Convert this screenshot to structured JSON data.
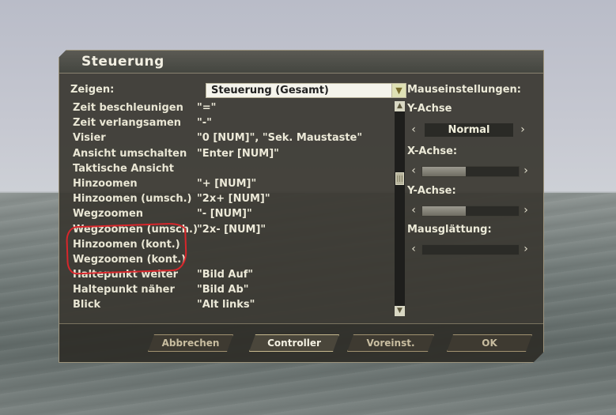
{
  "dialog": {
    "title": "Steuerung"
  },
  "filter": {
    "label": "Zeigen:",
    "value": "Steuerung (Gesamt)"
  },
  "bindings": [
    {
      "action": "Zeit beschleunigen",
      "key": "\"=\""
    },
    {
      "action": "Zeit verlangsamen",
      "key": "\"-\""
    },
    {
      "action": "Visier",
      "key": "\"0 [NUM]\", \"Sek. Maustaste\""
    },
    {
      "action": "Ansicht umschalten",
      "key": "\"Enter [NUM]\""
    },
    {
      "action": "Taktische Ansicht",
      "key": ""
    },
    {
      "action": "Hinzoomen",
      "key": "\"+ [NUM]\""
    },
    {
      "action": "Hinzoomen (umsch.)",
      "key": "\"2x+ [NUM]\""
    },
    {
      "action": "Wegzoomen",
      "key": "\"- [NUM]\""
    },
    {
      "action": "Wegzoomen (umsch.)",
      "key": "\"2x- [NUM]\""
    },
    {
      "action": "Hinzoomen (kont.)",
      "key": ""
    },
    {
      "action": "Wegzoomen (kont.)",
      "key": ""
    },
    {
      "action": "Haltepunkt weiter",
      "key": "\"Bild Auf\""
    },
    {
      "action": "Haltepunkt näher",
      "key": "\"Bild Ab\""
    },
    {
      "action": "Blick",
      "key": "\"Alt links\""
    }
  ],
  "mouse": {
    "heading": "Mauseinstellungen:",
    "y_axis_label": "Y-Achse",
    "y_axis_value": "Normal",
    "x_axis_label": "X-Achse:",
    "x_axis_fill": 0.45,
    "y_sens_label": "Y-Achse:",
    "y_sens_fill": 0.45,
    "smoothing_label": "Mausglättung:",
    "smoothing_fill": 0.0
  },
  "buttons": {
    "cancel": "Abbrechen",
    "controller": "Controller",
    "defaults": "Voreinst.",
    "ok": "OK"
  },
  "icons": {
    "left_arrow": "chevron-left-icon",
    "right_arrow": "chevron-right-icon",
    "dropdown_arrow": "chevron-down-icon",
    "scroll_up": "chevron-up-icon",
    "scroll_down": "chevron-down-icon"
  }
}
